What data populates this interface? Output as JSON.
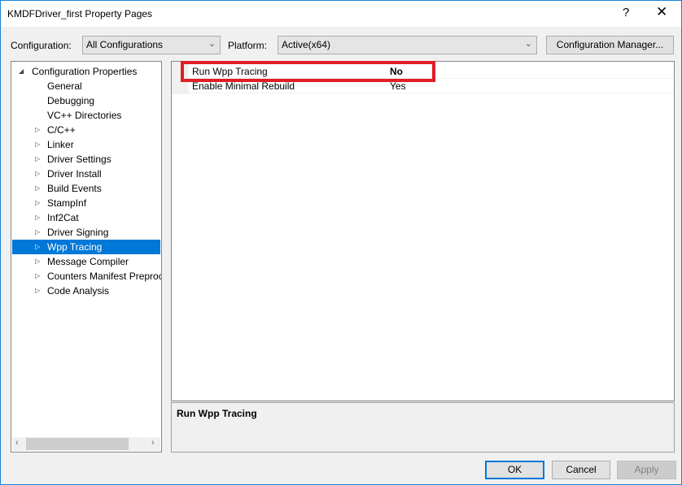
{
  "window": {
    "title": "KMDFDriver_first Property Pages",
    "help": "?",
    "close": "✕"
  },
  "toolbar": {
    "configuration_label": "Configuration:",
    "configuration_value": "All Configurations",
    "platform_label": "Platform:",
    "platform_value": "Active(x64)",
    "config_manager": "Configuration Manager..."
  },
  "tree": {
    "root": "Configuration Properties",
    "items": [
      {
        "label": "General",
        "expandable": false
      },
      {
        "label": "Debugging",
        "expandable": false
      },
      {
        "label": "VC++ Directories",
        "expandable": false
      },
      {
        "label": "C/C++",
        "expandable": true
      },
      {
        "label": "Linker",
        "expandable": true
      },
      {
        "label": "Driver Settings",
        "expandable": true
      },
      {
        "label": "Driver Install",
        "expandable": true
      },
      {
        "label": "Build Events",
        "expandable": true
      },
      {
        "label": "StampInf",
        "expandable": true
      },
      {
        "label": "Inf2Cat",
        "expandable": true
      },
      {
        "label": "Driver Signing",
        "expandable": true
      },
      {
        "label": "Wpp Tracing",
        "expandable": true,
        "selected": true
      },
      {
        "label": "Message Compiler",
        "expandable": true
      },
      {
        "label": "Counters Manifest Preproc",
        "expandable": true
      },
      {
        "label": "Code Analysis",
        "expandable": true
      }
    ]
  },
  "grid": {
    "rows": [
      {
        "name": "Run Wpp Tracing",
        "value": "No",
        "bold": true
      },
      {
        "name": "Enable Minimal Rebuild",
        "value": "Yes"
      }
    ]
  },
  "description": {
    "title": "Run Wpp Tracing"
  },
  "buttons": {
    "ok": "OK",
    "cancel": "Cancel",
    "apply": "Apply"
  },
  "colors": {
    "selection": "#0078d7",
    "highlight_box": "#e01e26"
  }
}
